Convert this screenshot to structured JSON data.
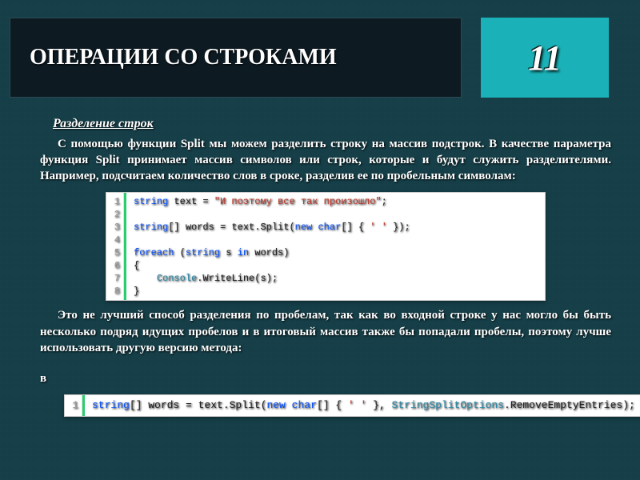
{
  "header": {
    "title": "ОПЕРАЦИИ СО СТРОКАМИ",
    "page_number": "11"
  },
  "section": {
    "subtitle": "Разделение строк",
    "para1": "С помощью функции Split мы можем разделить строку на массив подстрок. В качестве параметра функция Split принимает массив символов или строк, которые и будут служить разделителями. Например, подсчитаем количество слов в сроке, разделив ее по пробельным символам:",
    "para2": "Это не лучший способ разделения по пробелам, так как во входной строке у нас могло бы быть несколько подряд идущих пробелов и в итоговый массив также бы попадали пробелы, поэтому лучше использовать другую версию метода:",
    "para3_fragment": "в"
  },
  "code1": {
    "lines": [
      {
        "n": "1",
        "tokens": [
          {
            "t": "string",
            "c": "kw"
          },
          {
            "t": " text = "
          },
          {
            "t": "\"И поэтому все так произошло\"",
            "c": "str"
          },
          {
            "t": ";"
          }
        ]
      },
      {
        "n": "2",
        "tokens": []
      },
      {
        "n": "3",
        "tokens": [
          {
            "t": "string",
            "c": "kw"
          },
          {
            "t": "[] words = text.Split("
          },
          {
            "t": "new",
            "c": "kw"
          },
          {
            "t": " "
          },
          {
            "t": "char",
            "c": "kw"
          },
          {
            "t": "[] { "
          },
          {
            "t": "' '",
            "c": "str"
          },
          {
            "t": " });"
          }
        ]
      },
      {
        "n": "4",
        "tokens": []
      },
      {
        "n": "5",
        "tokens": [
          {
            "t": "foreach",
            "c": "kw"
          },
          {
            "t": " ("
          },
          {
            "t": "string",
            "c": "kw"
          },
          {
            "t": " s "
          },
          {
            "t": "in",
            "c": "kw"
          },
          {
            "t": " words)"
          }
        ]
      },
      {
        "n": "6",
        "tokens": [
          {
            "t": "{"
          }
        ]
      },
      {
        "n": "7",
        "tokens": [
          {
            "t": "    "
          },
          {
            "t": "Console",
            "c": "cls"
          },
          {
            "t": ".WriteLine(s);"
          }
        ]
      },
      {
        "n": "8",
        "tokens": [
          {
            "t": "}"
          }
        ]
      }
    ]
  },
  "code2": {
    "lines": [
      {
        "n": "1",
        "tokens": [
          {
            "t": "string",
            "c": "kw"
          },
          {
            "t": "[] words = text.Split("
          },
          {
            "t": "new",
            "c": "kw"
          },
          {
            "t": " "
          },
          {
            "t": "char",
            "c": "kw"
          },
          {
            "t": "[] { "
          },
          {
            "t": "' '",
            "c": "str"
          },
          {
            "t": " }, "
          },
          {
            "t": "StringSplitOptions",
            "c": "cls"
          },
          {
            "t": ".RemoveEmptyEntries);"
          }
        ]
      }
    ]
  }
}
